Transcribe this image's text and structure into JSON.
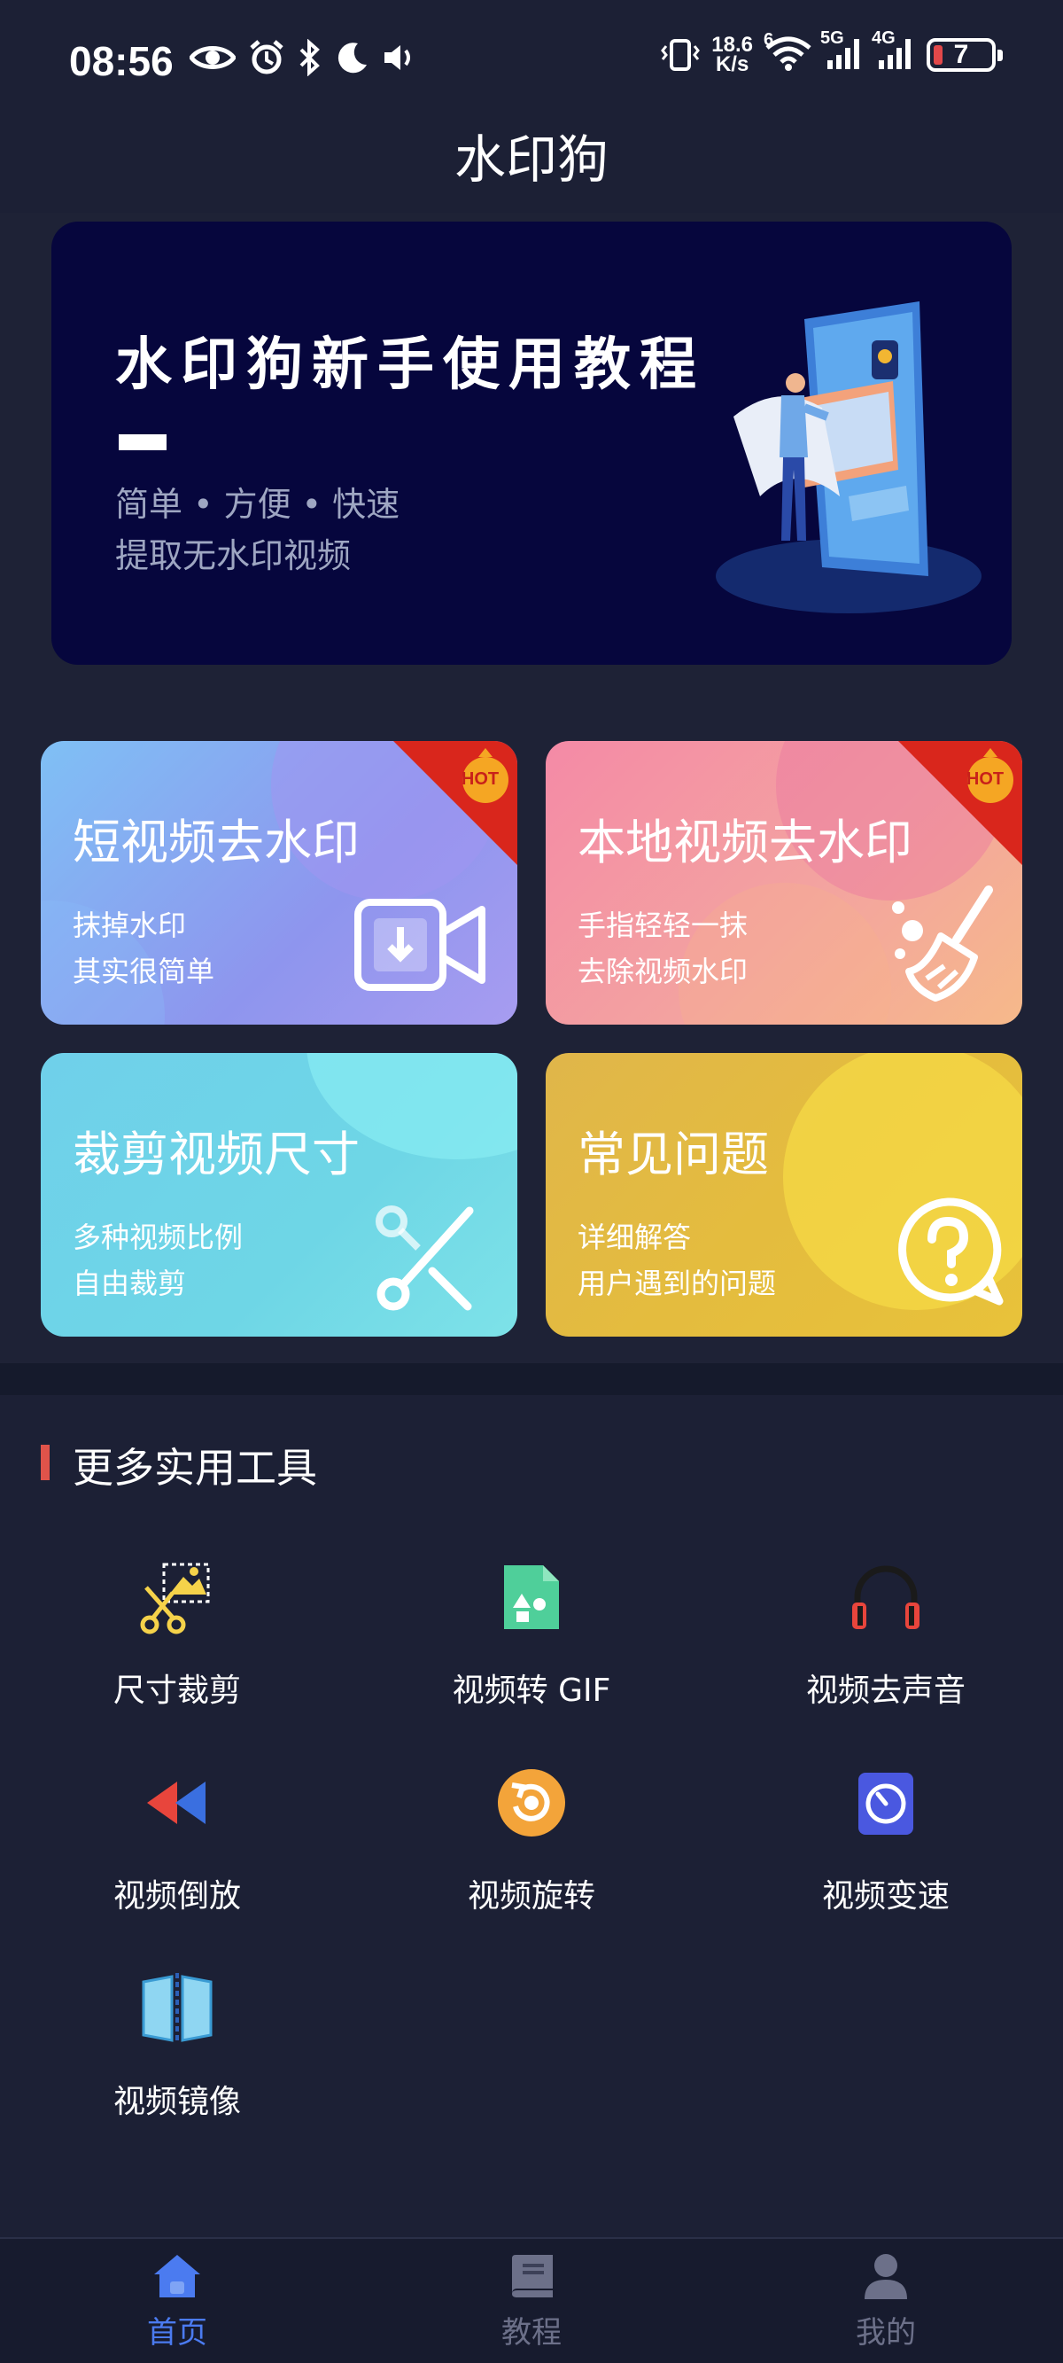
{
  "status_bar": {
    "time": "08:56",
    "net_speed_value": "18.6",
    "net_speed_unit": "K/s",
    "wifi_tag": "6",
    "sim1_tag": "5G",
    "sim2_tag": "4G",
    "battery_level": "7"
  },
  "app": {
    "title": "水印狗"
  },
  "banner": {
    "title": "水印狗新手使用教程",
    "subtitle_line1": "简单 • 方便 • 快速",
    "subtitle_line2": "提取无水印视频"
  },
  "cards": [
    {
      "title": "短视频去水印",
      "line1": "抹掉水印",
      "line2": "其实很简单",
      "badge": "HOT",
      "icon": "video-download-icon"
    },
    {
      "title": "本地视频去水印",
      "line1": "手指轻轻一抹",
      "line2": "去除视频水印",
      "badge": "HOT",
      "icon": "broom-icon"
    },
    {
      "title": "裁剪视频尺寸",
      "line1": "多种视频比例",
      "line2": "自由裁剪",
      "icon": "scissors-icon"
    },
    {
      "title": "常见问题",
      "line1": "详细解答",
      "line2": "用户遇到的问题",
      "icon": "question-bubble-icon"
    }
  ],
  "tools": {
    "section_title": "更多实用工具",
    "items": [
      {
        "label": "尺寸裁剪",
        "icon": "crop-scissors-icon"
      },
      {
        "label": "视频转 GIF",
        "icon": "gif-file-icon"
      },
      {
        "label": "视频去声音",
        "icon": "headphones-icon"
      },
      {
        "label": "视频倒放",
        "icon": "rewind-icon"
      },
      {
        "label": "视频旋转",
        "icon": "rotate-icon"
      },
      {
        "label": "视频变速",
        "icon": "speed-dial-icon"
      },
      {
        "label": "视频镜像",
        "icon": "mirror-icon"
      }
    ]
  },
  "bottom_nav": {
    "items": [
      {
        "label": "首页",
        "icon": "home-icon",
        "active": true
      },
      {
        "label": "教程",
        "icon": "book-icon",
        "active": false
      },
      {
        "label": "我的",
        "icon": "user-icon",
        "active": false
      }
    ]
  },
  "colors": {
    "background": "#1c2035",
    "banner": "#06063d",
    "accent_active": "#4b7bf0",
    "inactive_nav": "#6c7089",
    "section_marker": "#e0534a",
    "hot_badge": "#d9261c"
  }
}
